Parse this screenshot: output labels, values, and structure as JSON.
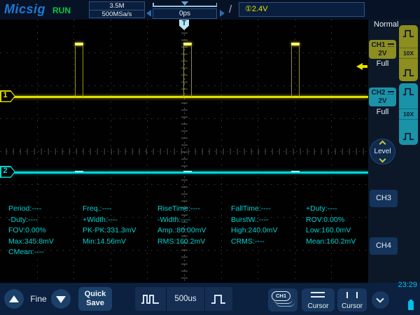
{
  "topbar": {
    "logo": "Micsig",
    "status": "RUN",
    "memory_depth": "3.5M",
    "sample_rate": "500MSa/s",
    "horizontal_position": "0ps",
    "trigger_edge": "/",
    "trigger_info": "①2.4V"
  },
  "scope": {
    "trigger_marker": "T",
    "ch1_flag": "1",
    "ch2_flag": "2",
    "pulses_x": [
      107,
      262,
      416
    ]
  },
  "measurements": {
    "columns": [
      [
        "Period:----",
        "-Duty:----",
        "FOV:0.00%",
        "Max:345.8mV",
        "CMean:----"
      ],
      [
        "Freq.:----",
        "+Width:----",
        "PK-PK:331.3mV",
        "Min:14.56mV"
      ],
      [
        "RiseTime:----",
        "-Width:----",
        "Amp.:80.00mV",
        "RMS:160.2mV"
      ],
      [
        "FallTime:----",
        "BurstW.:----",
        "High:240.0mV",
        "CRMS:----"
      ],
      [
        "+Duty:----",
        "ROV:0.00%",
        "Low:160.0mV",
        "Mean:160.2mV"
      ]
    ]
  },
  "sidebar": {
    "acquire_mode": "Normal",
    "ch1": {
      "name": "CH1",
      "scale": "2V",
      "bandwidth": "Full",
      "attenuation": "10X"
    },
    "ch2": {
      "name": "CH2",
      "scale": "2V",
      "bandwidth": "Full",
      "attenuation": "10X"
    },
    "level_label": "Level",
    "ch3_label": "CH3",
    "ch4_label": "CH4"
  },
  "bottombar": {
    "fine_label": "Fine",
    "quick_save_label": "Quick Save",
    "timebase": "500us",
    "channel_button": "CH1",
    "cursor_h_label": "Cursor",
    "cursor_v_label": "Cursor",
    "clock": "23:29"
  },
  "colors": {
    "ch1_yellow": "#e8e000",
    "ch2_cyan": "#00d8d8",
    "run_green": "#00cc44",
    "logo_blue": "#1d7ad2",
    "measurement_cyan": "#00d2d2",
    "trigger_yellow": "#e8e400"
  }
}
